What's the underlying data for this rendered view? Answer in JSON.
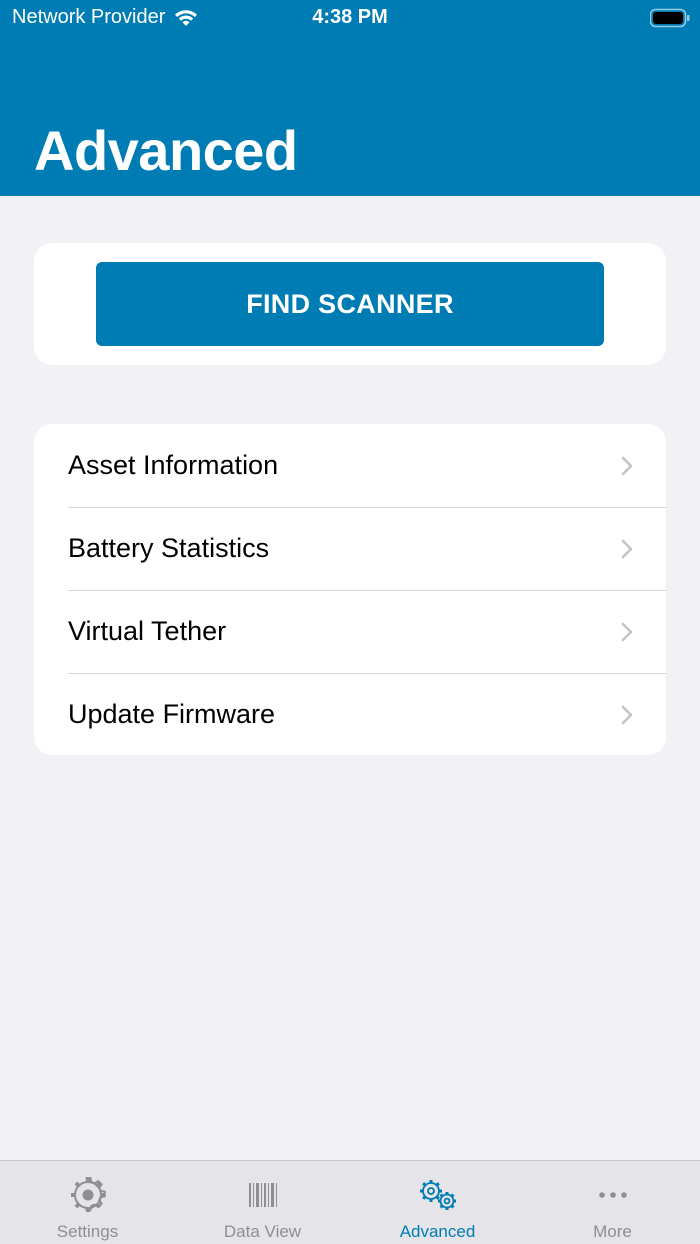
{
  "status_bar": {
    "carrier": "Network Provider",
    "time": "4:38 PM"
  },
  "header": {
    "title": "Advanced",
    "background_color": "#007cb4"
  },
  "scanner_card": {
    "button_label": "FIND SCANNER"
  },
  "menu": {
    "items": [
      {
        "label": "Asset Information",
        "icon": "chevron-right-icon"
      },
      {
        "label": "Battery Statistics",
        "icon": "chevron-right-icon"
      },
      {
        "label": "Virtual Tether",
        "icon": "chevron-right-icon"
      },
      {
        "label": "Update Firmware",
        "icon": "chevron-right-icon"
      }
    ]
  },
  "tab_bar": {
    "active_color": "#007cb4",
    "inactive_color": "#8e8e93",
    "tabs": [
      {
        "label": "Settings",
        "icon": "gear-icon",
        "active": false
      },
      {
        "label": "Data View",
        "icon": "barcode-icon",
        "active": false
      },
      {
        "label": "Advanced",
        "icon": "gears-icon",
        "active": true
      },
      {
        "label": "More",
        "icon": "ellipsis-icon",
        "active": false
      }
    ]
  }
}
